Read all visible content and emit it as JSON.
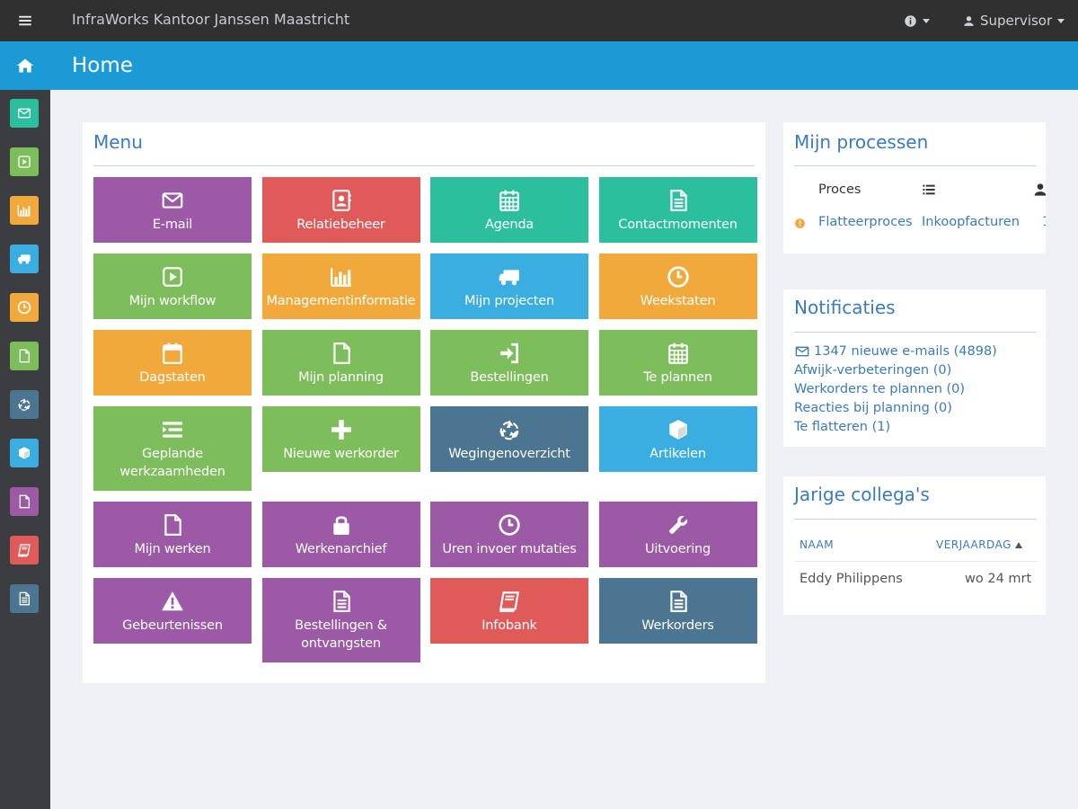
{
  "topbar": {
    "title": "InfraWorks Kantoor Janssen Maastricht",
    "user_label": "Supervisor"
  },
  "header": {
    "title": "Home"
  },
  "colors": {
    "purple": "#9b59a6",
    "red": "#e05a5a",
    "teal": "#2bbf9d",
    "green": "#7dbd5b",
    "orange": "#f2a93b",
    "blue": "#3aaee0",
    "slate": "#4b7590",
    "header_blue": "#1c9ad6"
  },
  "sidebar": {
    "items": [
      {
        "icon": "envelope-icon",
        "color": "#2bbf9d"
      },
      {
        "icon": "play-icon",
        "color": "#7dbd5b"
      },
      {
        "icon": "bar-chart-icon",
        "color": "#f2a93b"
      },
      {
        "icon": "truck-icon",
        "color": "#3aaee0"
      },
      {
        "icon": "clock-icon",
        "color": "#f2a93b"
      },
      {
        "icon": "file-icon",
        "color": "#7dbd5b"
      },
      {
        "icon": "recycle-icon",
        "color": "#4b7590"
      },
      {
        "icon": "cube-icon",
        "color": "#3aaee0"
      },
      {
        "icon": "file-icon",
        "color": "#9b59a6"
      },
      {
        "icon": "book-icon",
        "color": "#e05a5a"
      },
      {
        "icon": "file-text-icon",
        "color": "#4b7590"
      }
    ]
  },
  "menu": {
    "title": "Menu",
    "tiles": [
      {
        "label": "E-mail",
        "icon": "envelope-icon",
        "color": "#9b59a6"
      },
      {
        "label": "Relatiebeheer",
        "icon": "contact-book-icon",
        "color": "#e05a5a"
      },
      {
        "label": "Agenda",
        "icon": "calendar-icon",
        "color": "#2bbf9d"
      },
      {
        "label": "Contactmomenten",
        "icon": "file-text-icon",
        "color": "#2bbf9d"
      },
      {
        "label": "Mijn workflow",
        "icon": "play-icon",
        "color": "#7dbd5b"
      },
      {
        "label": "Managementinformatie",
        "icon": "bar-chart-icon",
        "color": "#f2a93b"
      },
      {
        "label": "Mijn projecten",
        "icon": "truck-icon",
        "color": "#3aaee0"
      },
      {
        "label": "Weekstaten",
        "icon": "clock-icon",
        "color": "#f2a93b"
      },
      {
        "label": "Dagstaten",
        "icon": "calendar-blank-icon",
        "color": "#f2a93b"
      },
      {
        "label": "Mijn planning",
        "icon": "file-icon",
        "color": "#7dbd5b"
      },
      {
        "label": "Bestellingen",
        "icon": "sign-in-icon",
        "color": "#7dbd5b"
      },
      {
        "label": "Te plannen",
        "icon": "calendar-icon",
        "color": "#7dbd5b"
      },
      {
        "label": "Geplande werkzaamheden",
        "icon": "list-icon",
        "color": "#7dbd5b"
      },
      {
        "label": "Nieuwe werkorder",
        "icon": "plus-icon",
        "color": "#7dbd5b"
      },
      {
        "label": "Wegingenoverzicht",
        "icon": "recycle-icon",
        "color": "#4b7590"
      },
      {
        "label": "Artikelen",
        "icon": "cube-icon",
        "color": "#3aaee0"
      },
      {
        "label": "Mijn werken",
        "icon": "file-icon",
        "color": "#9b59a6"
      },
      {
        "label": "Werkenarchief",
        "icon": "lock-icon",
        "color": "#9b59a6"
      },
      {
        "label": "Uren invoer mutaties",
        "icon": "clock-icon",
        "color": "#9b59a6"
      },
      {
        "label": "Uitvoering",
        "icon": "wrench-icon",
        "color": "#9b59a6"
      },
      {
        "label": "Gebeurtenissen",
        "icon": "warning-icon",
        "color": "#9b59a6"
      },
      {
        "label": "Bestellingen & ontvangsten",
        "icon": "file-text-icon",
        "color": "#9b59a6"
      },
      {
        "label": "Infobank",
        "icon": "book-icon",
        "color": "#e05a5a"
      },
      {
        "label": "Werkorders",
        "icon": "file-text-icon",
        "color": "#4b7590"
      }
    ]
  },
  "processes": {
    "title": "Mijn processen",
    "col_proces": "Proces",
    "rows": [
      {
        "name": "Flatteerproces",
        "type": "Inkoopfacturen",
        "count": "1"
      }
    ]
  },
  "notifications": {
    "title": "Notificaties",
    "items": [
      "1347 nieuwe e-mails (4898)",
      "Afwijk-verbeteringen (0)",
      "Werkorders te plannen (0)",
      "Reacties bij planning (0)",
      "Te flatteren (1)"
    ]
  },
  "birthdays": {
    "title": "Jarige collega's",
    "col_name": "NAAM",
    "col_date": "VERJAARDAG",
    "rows": [
      {
        "name": "Eddy Philippens",
        "date": "wo 24 mrt"
      }
    ]
  }
}
